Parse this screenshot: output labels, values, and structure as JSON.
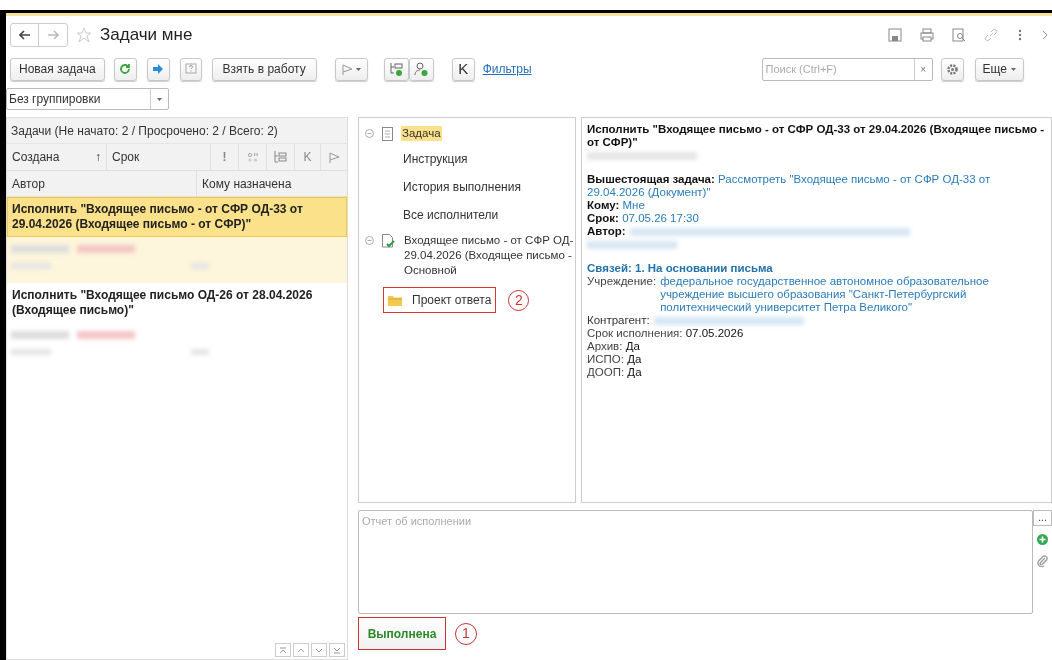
{
  "window": {
    "title": "Задачи мне",
    "favorite": false
  },
  "toolbar": {
    "new_task": "Новая задача",
    "take": "Взять в работу",
    "k": "K",
    "filters": "Фильтры",
    "search_placeholder": "Поиск (Ctrl+F)",
    "clear": "×",
    "more": "Еще"
  },
  "grouping": {
    "value": "Без группировки"
  },
  "task_list": {
    "summary": "Задачи (Не начато: 2 / Просрочено: 2 / Всего: 2)",
    "columns": [
      {
        "label": "Создана",
        "sort": "↑"
      },
      {
        "label": "Срок"
      },
      {
        "label": "!"
      },
      {
        "label": "K"
      }
    ],
    "columns_row2": [
      "Автор",
      "Кому назначена"
    ],
    "rows": [
      {
        "title": "Исполнить \"Входящее письмо - от СФР ОД-33 от 29.04.2026 (Входящее письмо - от СФР)\"",
        "selected": true
      },
      {
        "title": "Исполнить \"Входящее письмо ОД-26 от 28.04.2026 (Входящее письмо)\"",
        "selected": false
      }
    ]
  },
  "tree": [
    {
      "label": "Задача",
      "kind": "document",
      "expanded": true,
      "selected": true,
      "children": [
        {
          "label": "Инструкция",
          "selected": false
        },
        {
          "label": "История выполнения",
          "selected": false
        },
        {
          "label": "Все исполнители",
          "selected": false
        }
      ]
    },
    {
      "label": "Входящее письмо - от СФР ОД-\n29.04.2026 (Входящее письмо -\nОсновной",
      "kind": "document-check",
      "expanded": true,
      "selected": false,
      "children": [
        {
          "label": "Проект ответа",
          "kind": "folder",
          "selected": false,
          "callout": "2"
        }
      ]
    }
  ],
  "details": {
    "title": "Исполнить \"Входящее письмо - от СФР ОД-33 от 29.04.2026 (Входящее письмо - от СФР)\"",
    "sections": [
      {
        "fields": [
          {
            "kind": "bold_label",
            "label": "Вышестоящая задача:",
            "value": "Рассмотреть \"Входящее письмо - от СФР ОД-33 от 29.04.2026 (Документ)\""
          },
          {
            "kind": "bold_label",
            "label": "Кому:",
            "value": "Мне"
          },
          {
            "kind": "bold_label",
            "label": "Срок:",
            "value": "07.05.26 17:30"
          },
          {
            "kind": "bold_label",
            "label": "Автор:",
            "redacted": true
          }
        ]
      },
      {
        "heading": "Связей: 1. На основании письма",
        "fields": [
          {
            "kind": "plain_link",
            "label": "Учреждение:",
            "value": "федеральное государственное автономное образовательное учреждение высшего образования \"Санкт-Петербургский политехнический университет Петра Великого\""
          },
          {
            "kind": "plain_link",
            "label": "Контрагент:",
            "redacted": true
          },
          {
            "kind": "plain",
            "label": "Срок исполнения:",
            "value": "07.05.2026"
          },
          {
            "kind": "plain",
            "label": "Архив:",
            "value": "Да"
          },
          {
            "kind": "plain",
            "label": "ИСПО:",
            "value": "Да"
          },
          {
            "kind": "plain",
            "label": "ДООП:",
            "value": "Да"
          }
        ]
      }
    ]
  },
  "report": {
    "placeholder": "Отчет об исполнении",
    "more": "..."
  },
  "complete_button": {
    "label": "Выполнена",
    "callout": "1"
  }
}
